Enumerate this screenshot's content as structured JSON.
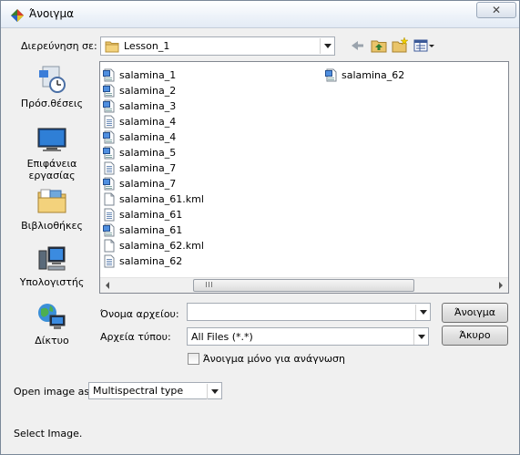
{
  "title": "Άνοιγμα",
  "close_glyph": "✕",
  "look_in": {
    "label": "Διερεύνηση σε:",
    "value": "Lesson_1"
  },
  "places": [
    {
      "label": "Πρόσ.θέσεις",
      "icon": "recent-places-icon"
    },
    {
      "label": "Επιφάνεια εργασίας",
      "icon": "desktop-icon"
    },
    {
      "label": "Βιβλιοθήκες",
      "icon": "libraries-icon"
    },
    {
      "label": "Υπολογιστής",
      "icon": "computer-icon"
    },
    {
      "label": "Δίκτυο",
      "icon": "network-icon"
    }
  ],
  "files": [
    {
      "name": "salamina_1",
      "icon": "image-file-icon"
    },
    {
      "name": "salamina_2",
      "icon": "image-file-icon"
    },
    {
      "name": "salamina_3",
      "icon": "image-file-icon"
    },
    {
      "name": "salamina_4",
      "icon": "document-file-icon"
    },
    {
      "name": "salamina_4",
      "icon": "image-file-icon"
    },
    {
      "name": "salamina_5",
      "icon": "image-file-icon"
    },
    {
      "name": "salamina_7",
      "icon": "document-file-icon"
    },
    {
      "name": "salamina_7",
      "icon": "image-file-icon"
    },
    {
      "name": "salamina_61.kml",
      "icon": "blank-file-icon"
    },
    {
      "name": "salamina_61",
      "icon": "document-file-icon"
    },
    {
      "name": "salamina_61",
      "icon": "image-file-icon"
    },
    {
      "name": "salamina_62.kml",
      "icon": "blank-file-icon"
    },
    {
      "name": "salamina_62",
      "icon": "document-file-icon"
    },
    {
      "name": "salamina_62",
      "icon": "image-file-icon"
    }
  ],
  "filename": {
    "label": "Όνομα αρχείου:",
    "value": ""
  },
  "filetype": {
    "label": "Αρχεία τύπου:",
    "value": "All Files (*.*)"
  },
  "open_button": "Άνοιγμα",
  "cancel_button": "Άκυρο",
  "readonly_checkbox": {
    "label": "Άνοιγμα μόνο για ανάγνωση",
    "checked": false
  },
  "open_image_as": {
    "label": "Open image as:",
    "value": "Multispectral type"
  },
  "status": "Select Image."
}
